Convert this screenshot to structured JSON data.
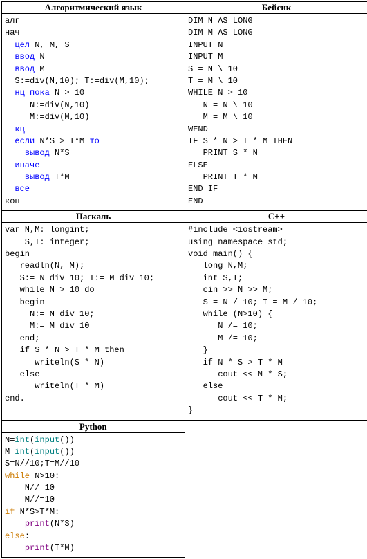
{
  "headers": {
    "alg": "Алгоритмический язык",
    "basic": "Бейсик",
    "pascal": "Паскаль",
    "cpp": "С++",
    "python": "Python"
  },
  "code": {
    "alg": {
      "l1": "алг",
      "l2": "нач",
      "l3a": "  ",
      "l3b": "цел",
      "l3c": " N, M, S",
      "l4a": "  ",
      "l4b": "ввод",
      "l4c": " N",
      "l5a": "  ",
      "l5b": "ввод",
      "l5c": " M",
      "l6": "  S:=div(N,10); T:=div(M,10);",
      "l7a": "  ",
      "l7b": "нц пока",
      "l7c": " N > 10",
      "l8": "     N:=div(N,10)",
      "l9": "     M:=div(M,10)",
      "l10a": "  ",
      "l10b": "кц",
      "l11a": "  ",
      "l11b": "если",
      "l11c": " N*S > T*M ",
      "l11d": "то",
      "l12a": "    ",
      "l12b": "вывод",
      "l12c": " N*S",
      "l13a": "  ",
      "l13b": "иначе",
      "l14a": "    ",
      "l14b": "вывод",
      "l14c": " T*M",
      "l15a": "  ",
      "l15b": "все",
      "l16": "кон"
    },
    "basic": {
      "l1": "DIM N AS LONG",
      "l2": "DIM M AS LONG",
      "l3": "INPUT N",
      "l4": "INPUT M",
      "l5": "S = N \\ 10",
      "l6": "T = M \\ 10",
      "l7": "WHILE N > 10",
      "l8": "   N = N \\ 10",
      "l9": "   M = M \\ 10",
      "l10": "WEND",
      "l11": "IF S * N > T * M THEN",
      "l12": "   PRINT S * N",
      "l13": "ELSE",
      "l14": "   PRINT T * M",
      "l15": "END IF",
      "l16": "END"
    },
    "pascal": {
      "l1": "var N,M: longint;",
      "l2": "    S,T: integer;",
      "l3": "begin",
      "l4": "   readln(N, M);",
      "l5": "   S:= N div 10; T:= M div 10;",
      "l6": "   while N > 10 do",
      "l7": "   begin",
      "l8": "     N:= N div 10;",
      "l9": "     M:= M div 10",
      "l10": "   end;",
      "l11": "   if S * N > T * M then",
      "l12": "      writeln(S * N)",
      "l13": "   else",
      "l14": "      writeln(T * M)",
      "l15": "end."
    },
    "cpp": {
      "l1": "#include <iostream>",
      "l2": "using namespace std;",
      "l3": "void main() {",
      "l4": "   long N,M;",
      "l5": "   int S,T;",
      "l6": "   cin >> N >> M;",
      "l7": "   S = N / 10; T = M / 10;",
      "l8": "   while (N>10) {",
      "l9": "      N /= 10;",
      "l10": "      M /= 10;",
      "l11": "   }",
      "l12": "   if N * S > T * M",
      "l13": "      cout << N * S;",
      "l14": "   else",
      "l15": "      cout << T * M;",
      "l16": "}"
    },
    "python": {
      "l1a": "N=",
      "l1b": "int",
      "l1c": "(",
      "l1d": "input",
      "l1e": "())",
      "l2a": "M=",
      "l2b": "int",
      "l2c": "(",
      "l2d": "input",
      "l2e": "())",
      "l3": "S=N//10;T=M//10",
      "l4a": "while",
      "l4b": " N>10:",
      "l5": "    N//=10",
      "l6": "    M//=10",
      "l7a": "if",
      "l7b": " N*S>T*M:",
      "l8a": "    ",
      "l8b": "print",
      "l8c": "(N*S)",
      "l9a": "else",
      "l9b": ":",
      "l10a": "    ",
      "l10b": "print",
      "l10c": "(T*M)"
    }
  }
}
